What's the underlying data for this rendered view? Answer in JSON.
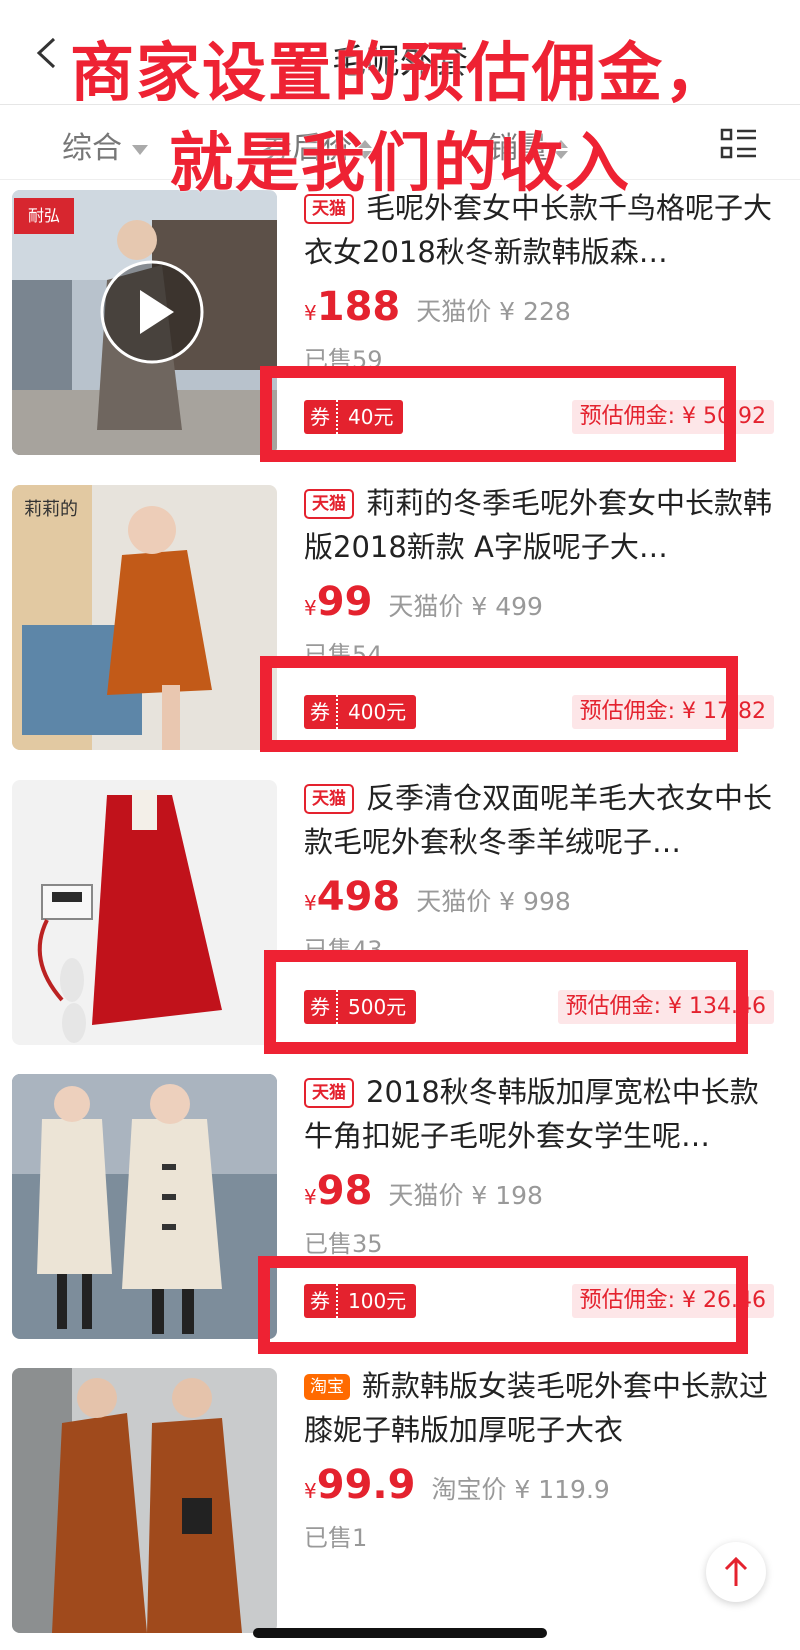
{
  "nav": {
    "title": "毛呢外套"
  },
  "sort_tabs": [
    {
      "label": "综合"
    },
    {
      "label": "券后价"
    },
    {
      "label": "销量"
    }
  ],
  "annotation": {
    "line1": "商家设置的预估佣金，",
    "line2": "就是我们的收入"
  },
  "items": [
    {
      "badge": "天猫",
      "title": "毛呢外套女中长款千鸟格呢子大衣女2018秋冬新款韩版森…",
      "price_symbol": "¥",
      "price": "188",
      "orig_label": "天猫价 ¥ 228",
      "sold": "已售59",
      "coupon_tag": "券",
      "coupon_value": "40元",
      "commission": "预估佣金: ¥ 50.92",
      "thumb_brand": "耐弘"
    },
    {
      "badge": "天猫",
      "title": "莉莉的冬季毛呢外套女中长款韩版2018新款 A字版呢子大…",
      "price_symbol": "¥",
      "price": "99",
      "orig_label": "天猫价 ¥ 499",
      "sold": "已售54",
      "coupon_tag": "券",
      "coupon_value": "400元",
      "commission": "预估佣金: ¥ 17.82",
      "thumb_brand": "莉莉的"
    },
    {
      "badge": "天猫",
      "title": "反季清仓双面呢羊毛大衣女中长款毛呢外套秋冬季羊绒呢子…",
      "price_symbol": "¥",
      "price": "498",
      "orig_label": "天猫价 ¥ 998",
      "sold": "已售43",
      "coupon_tag": "券",
      "coupon_value": "500元",
      "commission": "预估佣金: ¥ 134.46"
    },
    {
      "badge": "天猫",
      "title": "2018秋冬韩版加厚宽松中长款牛角扣妮子毛呢外套女学生呢…",
      "price_symbol": "¥",
      "price": "98",
      "orig_label": "天猫价 ¥ 198",
      "sold": "已售35",
      "coupon_tag": "券",
      "coupon_value": "100元",
      "commission": "预估佣金: ¥ 26.46"
    },
    {
      "badge": "淘宝",
      "title": "新款韩版女装毛呢外套中长款过膝妮子韩版加厚呢子大衣",
      "price_symbol": "¥",
      "price": "99.9",
      "orig_label": "淘宝价 ¥ 119.9",
      "sold": "已售1"
    }
  ],
  "colors": {
    "accent": "#e4222e",
    "annotation": "#ee2233"
  },
  "icons": {
    "back": "chevron-left-icon",
    "layout": "grid-list-icon",
    "play": "play-icon",
    "back_to_top": "arrow-up-icon"
  }
}
